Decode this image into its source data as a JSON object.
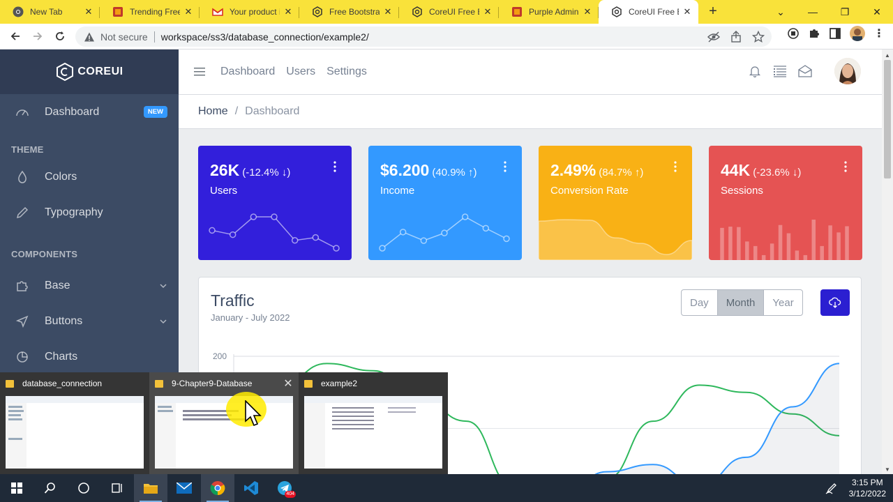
{
  "browser": {
    "tabs": [
      {
        "title": "New Tab",
        "icon": "chrome-icon",
        "active": false
      },
      {
        "title": "Trending Free",
        "icon": "colorlib-icon",
        "active": false
      },
      {
        "title": "Your product is",
        "icon": "gmail-icon",
        "active": false
      },
      {
        "title": "Free Bootstrap",
        "icon": "coreui-icon",
        "active": false
      },
      {
        "title": "CoreUI Free Bo",
        "icon": "coreui-icon",
        "active": false
      },
      {
        "title": "Purple Admin",
        "icon": "colorlib-icon",
        "active": false
      },
      {
        "title": "CoreUI Free Bo",
        "icon": "coreui-icon",
        "active": true
      }
    ],
    "security_label": "Not secure",
    "url": "workspace/ss3/database_connection/example2/"
  },
  "sidebar": {
    "brand": "COREUI",
    "dashboard_label": "Dashboard",
    "dashboard_badge": "NEW",
    "theme_title": "THEME",
    "colors_label": "Colors",
    "typography_label": "Typography",
    "components_title": "COMPONENTS",
    "base_label": "Base",
    "buttons_label": "Buttons",
    "charts_label": "Charts"
  },
  "header": {
    "nav": [
      "Dashboard",
      "Users",
      "Settings"
    ]
  },
  "breadcrumb": {
    "home": "Home",
    "separator": "/",
    "current": "Dashboard"
  },
  "cards": [
    {
      "value": "26K",
      "change": "(-12.4% ↓)",
      "label": "Users",
      "color": "#321fdb",
      "trend": [
        65,
        59,
        84,
        84,
        51,
        55,
        40
      ]
    },
    {
      "value": "$6.200",
      "change": "(40.9% ↑)",
      "label": "Income",
      "color": "#3399ff",
      "trend": [
        1,
        18,
        9,
        17,
        34,
        22,
        11
      ]
    },
    {
      "value": "2.49%",
      "change": "(84.7% ↑)",
      "label": "Conversion Rate",
      "color": "#f9b115",
      "trend": [
        78,
        81,
        80,
        45,
        34,
        12,
        40
      ]
    },
    {
      "value": "44K",
      "change": "(-23.6% ↓)",
      "label": "Sessions",
      "color": "#e55353",
      "trend": [
        78,
        81,
        80,
        45,
        34,
        12,
        40,
        85,
        65,
        23,
        12,
        98,
        34,
        84,
        67,
        82
      ]
    }
  ],
  "traffic": {
    "title": "Traffic",
    "subtitle": "January - July 2022",
    "segments": [
      "Day",
      "Month",
      "Year"
    ],
    "selected_segment": "Month"
  },
  "chart_data": {
    "type": "line",
    "title": "Traffic",
    "ylim": [
      0,
      250
    ],
    "yticks": [
      200
    ],
    "grid": true,
    "series": [
      {
        "values": [
          120,
          160,
          190,
          180,
          140,
          110,
          20,
          0,
          30,
          110,
          160,
          150,
          120,
          90
        ],
        "color": "#2eb85c"
      },
      {
        "values": [
          0,
          0,
          0,
          0,
          0,
          0,
          0,
          0,
          40,
          50,
          20,
          60,
          130,
          190
        ],
        "color": "#39f"
      }
    ]
  },
  "previews": [
    {
      "title": "database_connection"
    },
    {
      "title": "9-Chapter9-Database"
    },
    {
      "title": "example2"
    }
  ],
  "taskbar": {
    "time": "3:15 PM",
    "date": "3/12/2022",
    "telegram_badge": "404"
  }
}
